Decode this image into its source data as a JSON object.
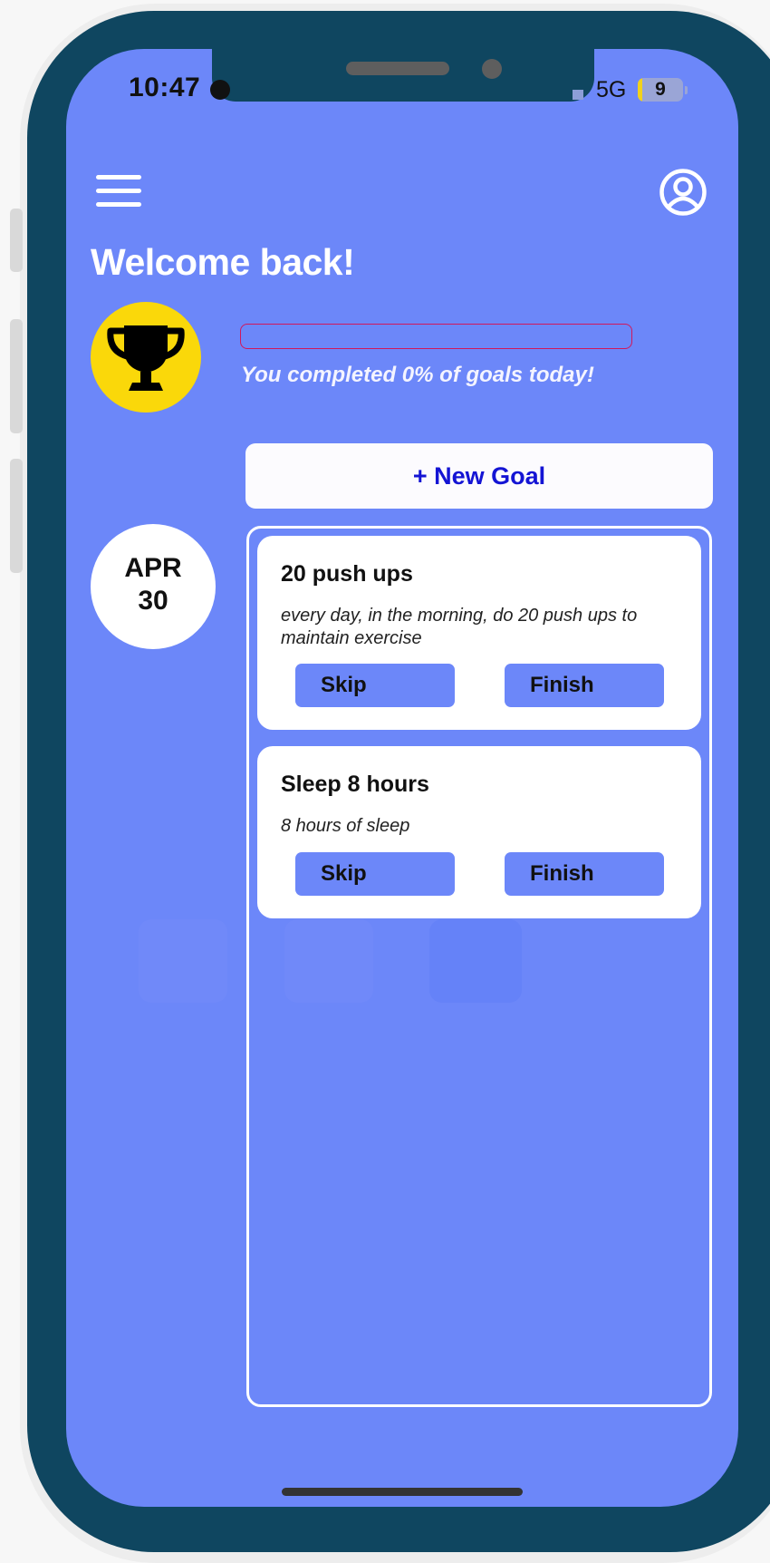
{
  "status_bar": {
    "time": "10:47",
    "network": "5G",
    "battery": "9",
    "battery_level": 0.09
  },
  "header": {
    "menu_icon": "hamburger-menu-icon",
    "profile_icon": "user-circle-icon"
  },
  "welcome": {
    "title": "Welcome back!"
  },
  "progress": {
    "icon": "trophy-icon",
    "percent": 0,
    "text": "You completed 0% of goals today!",
    "bar_color": "#d0185c"
  },
  "actions": {
    "new_goal_label": "+ New Goal"
  },
  "date": {
    "month": "APR",
    "day": "30"
  },
  "goals": [
    {
      "title": "20 push ups",
      "description": "every day, in the morning, do 20 push ups to maintain exercise",
      "skip_label": "Skip",
      "finish_label": "Finish"
    },
    {
      "title": "Sleep 8 hours",
      "description": "8 hours of sleep",
      "skip_label": "Skip",
      "finish_label": "Finish"
    }
  ],
  "colors": {
    "background": "#6c87f9",
    "frame": "#0f4660",
    "accent_text": "#1414d4",
    "trophy_badge": "#fad80a"
  }
}
